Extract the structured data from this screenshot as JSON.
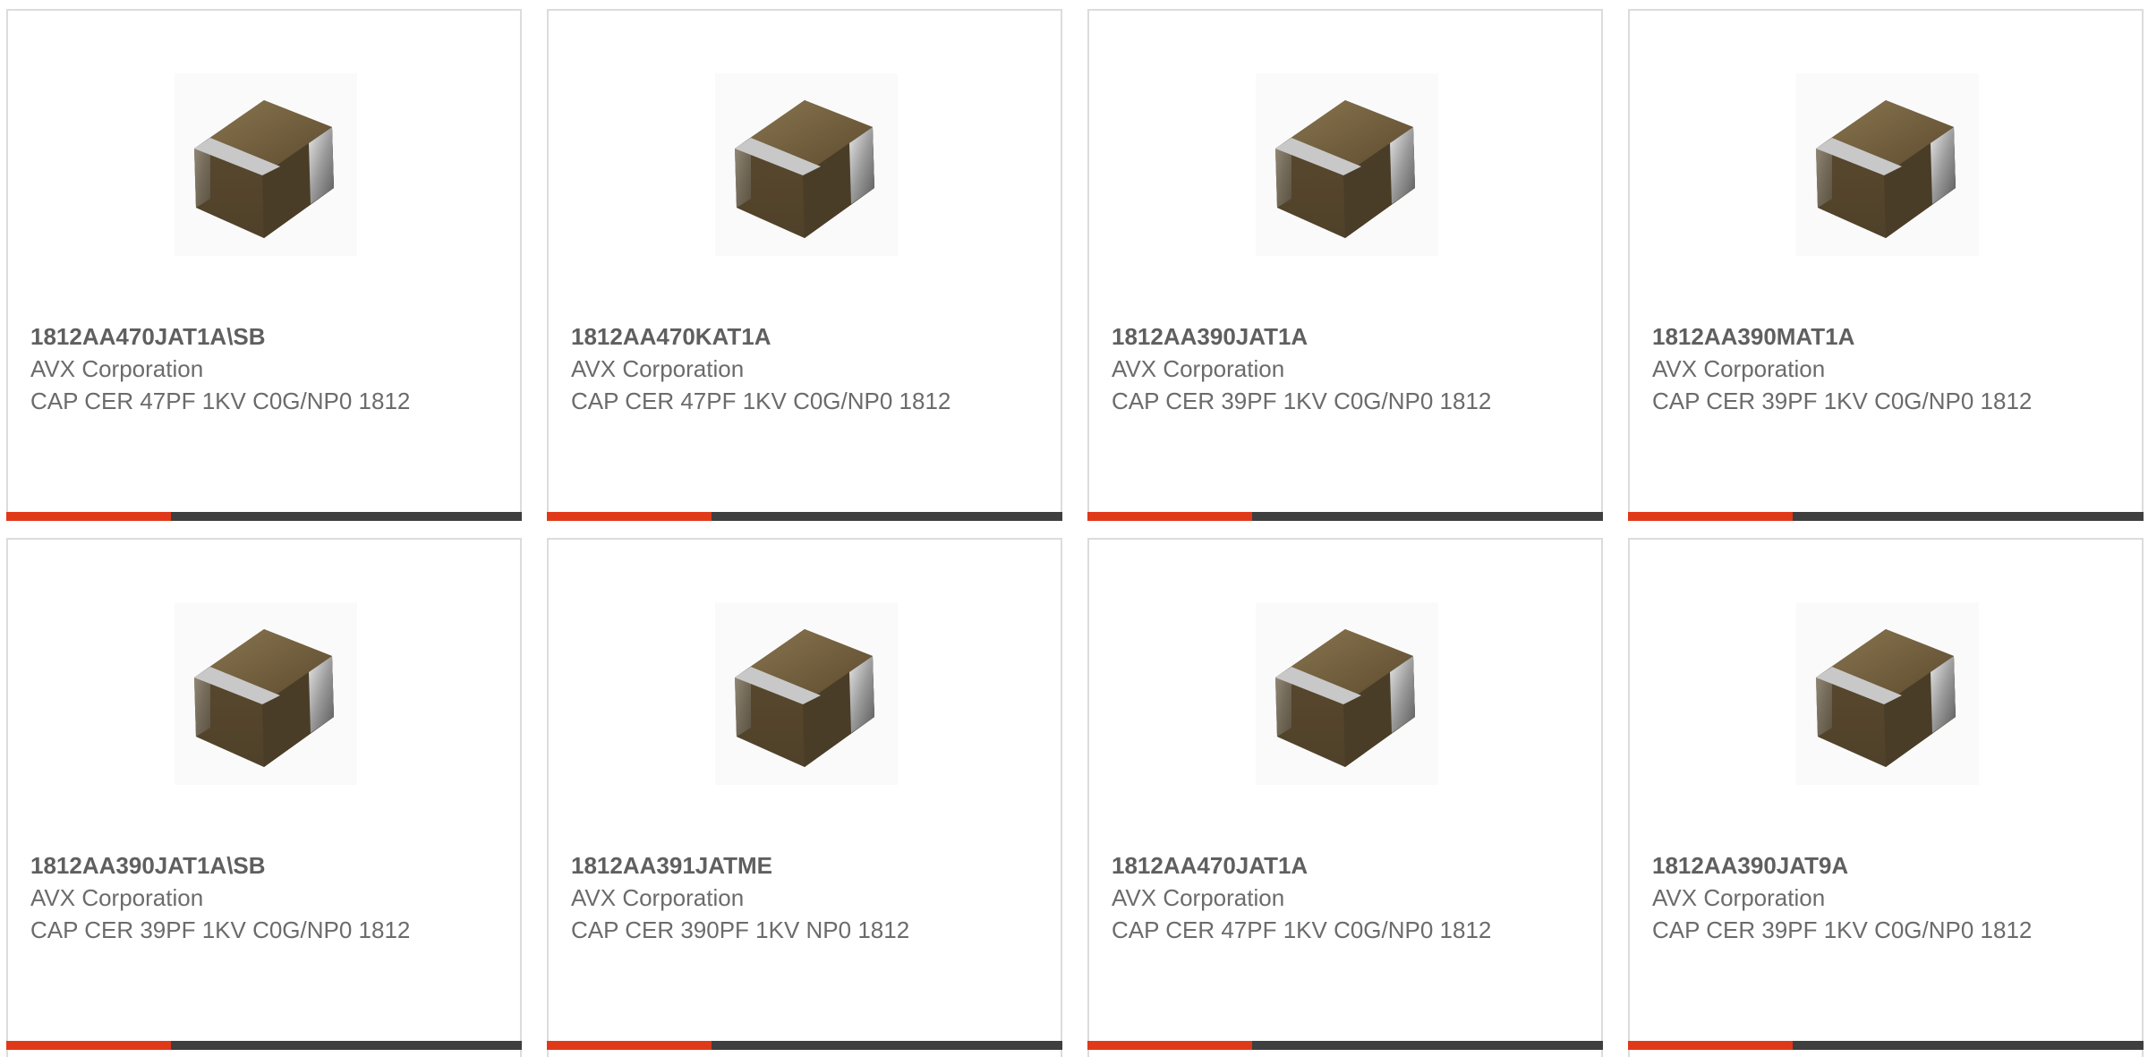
{
  "products": [
    {
      "part_number": "1812AA470JAT1A\\SB",
      "manufacturer": "AVX Corporation",
      "description": "CAP CER 47PF 1KV C0G/NP0 1812",
      "image": "ceramic-capacitor-chip-icon"
    },
    {
      "part_number": "1812AA470KAT1A",
      "manufacturer": "AVX Corporation",
      "description": "CAP CER 47PF 1KV C0G/NP0 1812",
      "image": "ceramic-capacitor-chip-icon"
    },
    {
      "part_number": "1812AA390JAT1A",
      "manufacturer": "AVX Corporation",
      "description": "CAP CER 39PF 1KV C0G/NP0 1812",
      "image": "ceramic-capacitor-chip-icon"
    },
    {
      "part_number": "1812AA390MAT1A",
      "manufacturer": "AVX Corporation",
      "description": "CAP CER 39PF 1KV C0G/NP0 1812",
      "image": "ceramic-capacitor-chip-icon"
    },
    {
      "part_number": "1812AA390JAT1A\\SB",
      "manufacturer": "AVX Corporation",
      "description": "CAP CER 39PF 1KV C0G/NP0 1812",
      "image": "ceramic-capacitor-chip-icon"
    },
    {
      "part_number": "1812AA391JATME",
      "manufacturer": "AVX Corporation",
      "description": "CAP CER 390PF 1KV NP0 1812",
      "image": "ceramic-capacitor-chip-icon"
    },
    {
      "part_number": "1812AA470JAT1A",
      "manufacturer": "AVX Corporation",
      "description": "CAP CER 47PF 1KV C0G/NP0 1812",
      "image": "ceramic-capacitor-chip-icon"
    },
    {
      "part_number": "1812AA390JAT9A",
      "manufacturer": "AVX Corporation",
      "description": "CAP CER 39PF 1KV C0G/NP0 1812",
      "image": "ceramic-capacitor-chip-icon"
    }
  ],
  "colors": {
    "accent": "#e0391a",
    "bar": "#3f3f3f",
    "border": "#dcdcdc",
    "text": "#6b6b6b"
  }
}
